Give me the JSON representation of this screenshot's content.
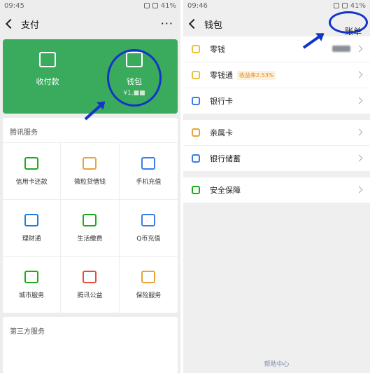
{
  "left": {
    "status": {
      "time": "09:45",
      "battery": "41%"
    },
    "nav": {
      "title": "支付",
      "more": "···"
    },
    "green_card": {
      "items": [
        {
          "label": "收付款"
        },
        {
          "label": "钱包",
          "sub": "¥1,■■"
        }
      ]
    },
    "tencent_services": {
      "title": "腾讯服务",
      "items": [
        {
          "label": "信用卡还款",
          "icon": "credit-card-icon",
          "color": "#1aad19"
        },
        {
          "label": "微粒贷借钱",
          "icon": "loan-icon",
          "color": "#e8a33b"
        },
        {
          "label": "手机充值",
          "icon": "phone-icon",
          "color": "#3a7de8"
        },
        {
          "label": "理财通",
          "icon": "wealth-icon",
          "color": "#1c7ed6"
        },
        {
          "label": "生活缴费",
          "icon": "utility-icon",
          "color": "#1aad19"
        },
        {
          "label": "Q币充值",
          "icon": "penguin-icon",
          "color": "#3a7de8"
        },
        {
          "label": "城市服务",
          "icon": "city-icon",
          "color": "#1aad19"
        },
        {
          "label": "腾讯公益",
          "icon": "heart-icon",
          "color": "#e84a3b"
        },
        {
          "label": "保险服务",
          "icon": "insurance-icon",
          "color": "#e8a33b"
        }
      ]
    },
    "third_party": {
      "title": "第三方服务"
    }
  },
  "right": {
    "status": {
      "time": "09:46",
      "battery": "41%"
    },
    "nav": {
      "title": "钱包",
      "bill": "账单"
    },
    "rows1": [
      {
        "label": "零钱",
        "icon": "coin-icon",
        "color": "#e8c23b",
        "amount": "¥1,■■"
      },
      {
        "label": "零钱通",
        "icon": "diamond-icon",
        "color": "#e8c23b",
        "badge": "收益率2.53%"
      },
      {
        "label": "银行卡",
        "icon": "bankcard-icon",
        "color": "#3a7de8"
      }
    ],
    "rows2": [
      {
        "label": "亲属卡",
        "icon": "family-card-icon",
        "color": "#e8a33b"
      },
      {
        "label": "银行储蓄",
        "icon": "savings-icon",
        "color": "#3a7de8"
      }
    ],
    "rows3": [
      {
        "label": "安全保障",
        "icon": "shield-icon",
        "color": "#1aad19"
      }
    ],
    "footer": {
      "help": "帮助中心"
    }
  }
}
